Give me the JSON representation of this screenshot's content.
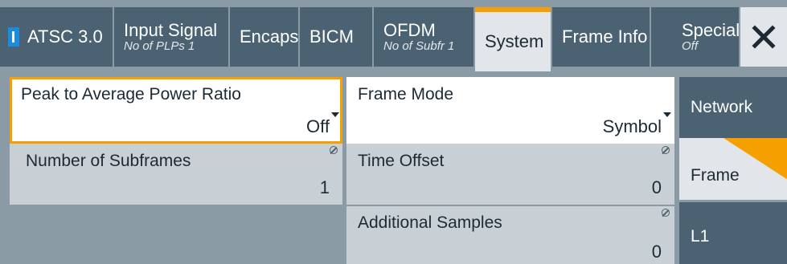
{
  "tabs": {
    "atsc": "ATSC 3.0",
    "input_signal": {
      "label": "Input Signal",
      "sub": "No of PLPs 1"
    },
    "encaps": "Encaps",
    "bicm": "BICM",
    "ofdm": {
      "label": "OFDM",
      "sub": "No of Subfr 1"
    },
    "system": "System",
    "frame_info": "Frame Info",
    "special": {
      "label": "Special",
      "sub": "Off"
    },
    "close_glyph": "✕"
  },
  "fields": {
    "papr": {
      "label": "Peak to Average Power Ratio",
      "value": "Off"
    },
    "frame_mode": {
      "label": "Frame Mode",
      "value": "Symbol"
    },
    "num_subframes": {
      "label": "Number of Subframes",
      "value": "1"
    },
    "time_offset": {
      "label": "Time Offset",
      "value": "0"
    },
    "additional_samples": {
      "label": "Additional Samples",
      "value": "0"
    }
  },
  "side_tabs": {
    "network": "Network",
    "frame": "Frame",
    "l1": "L1"
  },
  "colors": {
    "tab_bg": "#4a6272",
    "active_bg": "#e2e6ea",
    "accent": "#f5a000",
    "indicator": "#1b8bdc",
    "readonly_field": "#c8d0d6",
    "background": "#8b9ba5"
  },
  "icons": {
    "dropdown": "chevron-down-icon",
    "readonly": "lock-icon",
    "close": "close-icon"
  }
}
